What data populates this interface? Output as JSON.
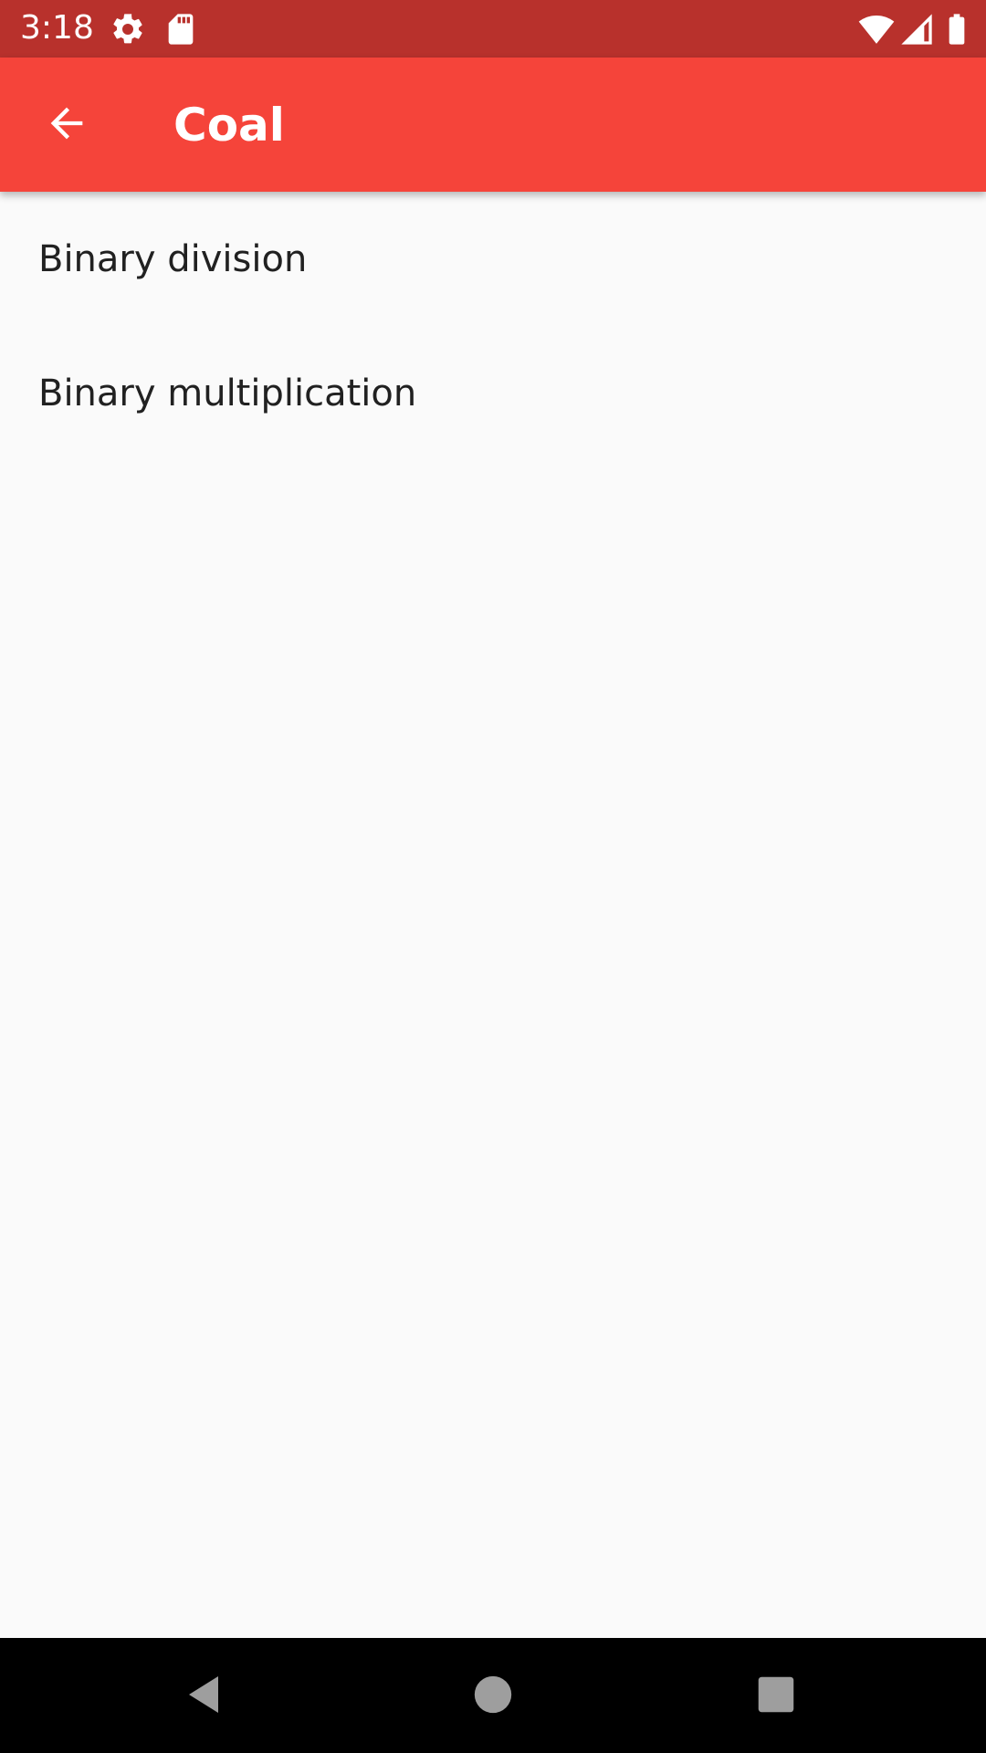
{
  "status_bar": {
    "time": "3:18",
    "background": "#b8312c",
    "icons": [
      "gear-icon",
      "sd-card-icon",
      "wifi-icon",
      "cell-signal-icon",
      "battery-icon"
    ]
  },
  "app_bar": {
    "title": "Coal",
    "background": "#f5443a",
    "back_icon": "arrow-back-icon"
  },
  "list": {
    "items": [
      {
        "label": "Binary division"
      },
      {
        "label": "Binary multiplication"
      }
    ]
  },
  "nav_bar": {
    "icons": [
      "back-triangle-icon",
      "home-circle-icon",
      "recents-square-icon"
    ]
  }
}
